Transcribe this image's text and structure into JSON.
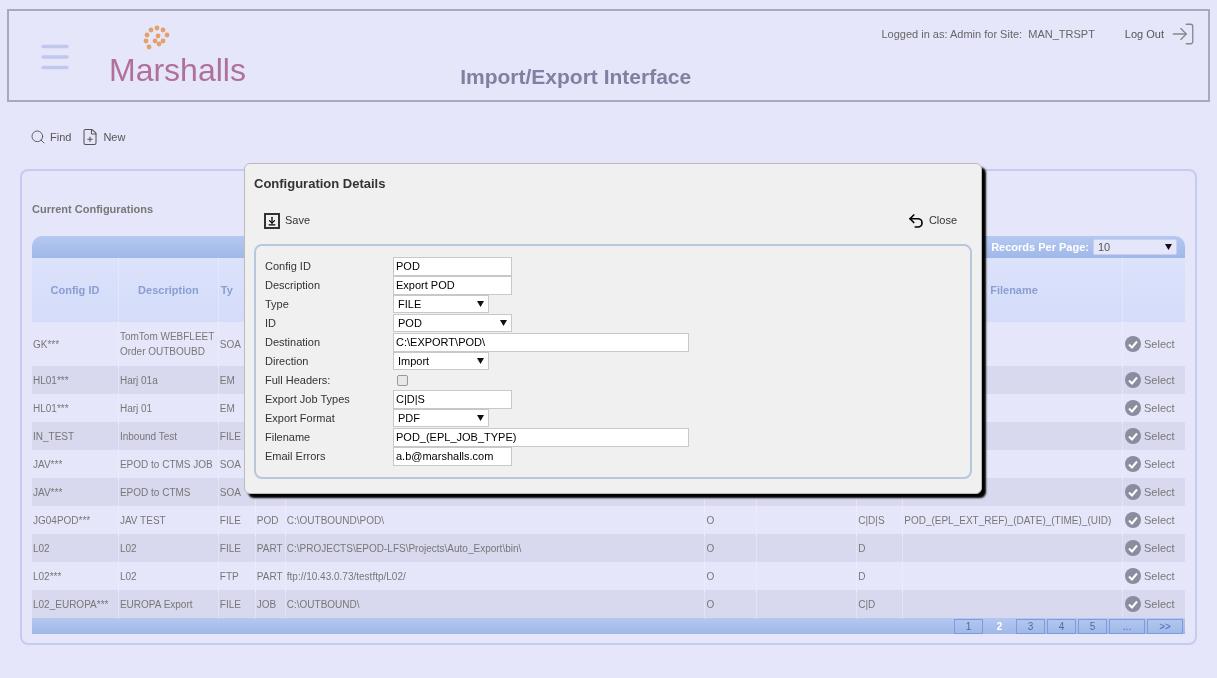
{
  "header": {
    "logo": "Marshalls",
    "title": "Import/Export Interface",
    "login_info": "Logged in as: Admin for Site:  MAN_TRSPT",
    "logout": "Log Out"
  },
  "toolbar": [
    "Find",
    "New"
  ],
  "panel": {
    "title": "Current Configurations",
    "records_per_page": {
      "label": "Records Per Page:",
      "value": "10"
    },
    "columns": {
      "config_id": "Config ID",
      "description": "Description",
      "type": "Ty",
      "filename": "Filename"
    },
    "rows": [
      {
        "config_id": "GK***",
        "description": "TomTom WEBFLEET Order OUTBOUBD",
        "type": "SOA",
        "action": "Select"
      },
      {
        "config_id": "HL01***",
        "description": "Harj 01a",
        "type": "EM",
        "action": "Select"
      },
      {
        "config_id": "HL01***",
        "description": "Harj 01",
        "type": "EM",
        "action": "Select"
      },
      {
        "config_id": "IN_TEST",
        "description": "Inbound Test",
        "type": "FILE",
        "action": "Select"
      },
      {
        "config_id": "JAV***",
        "description": "EPOD to CTMS JOB",
        "type": "SOA",
        "action": "Select"
      },
      {
        "config_id": "JAV***",
        "description": "EPOD to CTMS",
        "type": "SOA",
        "action": "Select"
      },
      {
        "config_id": "JG04POD***",
        "description": "JAV TEST",
        "type": "FILE",
        "id": "POD",
        "destination": "C:\\OUTBOUND\\POD\\",
        "column_6": "O",
        "column_8": "C|D|S",
        "filename": "POD_(EPL_EXT_REF)_(DATE)_(TIME)_(UID)",
        "action": "Select"
      },
      {
        "config_id": "L02",
        "description": "L02",
        "type": "FILE",
        "id": "PART",
        "destination": "C:\\PROJECTS\\EPOD-LFS\\Projects\\Auto_Export\\bin\\",
        "column_6": "O",
        "column_8": "D",
        "action": "Select"
      },
      {
        "config_id": "L02***",
        "description": "L02",
        "type": "FTP",
        "id": "PART",
        "destination": "ftp://10.43.0.73/testftp/L02/",
        "column_6": "O",
        "column_8": "D",
        "action": "Select"
      },
      {
        "config_id": "L02_EUROPA***",
        "description": "EUROPA Export",
        "type": "FILE",
        "id": "JOB",
        "destination": "C:\\OUTBOUND\\",
        "column_6": "O",
        "column_8": "C|D",
        "action": "Select"
      }
    ],
    "pages": [
      {
        "label": "1",
        "selected": false
      },
      {
        "label": "2",
        "selected": true
      },
      {
        "label": "3",
        "selected": false
      },
      {
        "label": "4",
        "selected": false
      },
      {
        "label": "5",
        "selected": false
      },
      {
        "label": "...",
        "selected": false
      },
      {
        "label": ">>",
        "selected": false
      }
    ]
  },
  "dialog": {
    "title": "Configuration Details",
    "save": "Save",
    "close": "Close",
    "fields": [
      {
        "label": "Config ID",
        "kind": "text",
        "value": "POD"
      },
      {
        "label": "Description",
        "kind": "text",
        "value": "Export POD"
      },
      {
        "label": "Type",
        "kind": "select",
        "value": "FILE"
      },
      {
        "label": "ID",
        "kind": "select",
        "value": "POD"
      },
      {
        "label": "Destination",
        "kind": "text",
        "value": "C:\\EXPORT\\POD\\"
      },
      {
        "label": "Direction",
        "kind": "select",
        "value": "Import"
      },
      {
        "label": "Full Headers:",
        "kind": "checkbox",
        "checked": false
      },
      {
        "label": "Export Job Types",
        "kind": "text",
        "value": "C|D|S"
      },
      {
        "label": "Export Format",
        "kind": "select",
        "value": "PDF"
      },
      {
        "label": "Filename",
        "kind": "text",
        "value": "POD_(EPL_JOB_TYPE)"
      },
      {
        "label": "Email Errors",
        "kind": "text",
        "value": "a.b@marshalls.com"
      }
    ]
  }
}
